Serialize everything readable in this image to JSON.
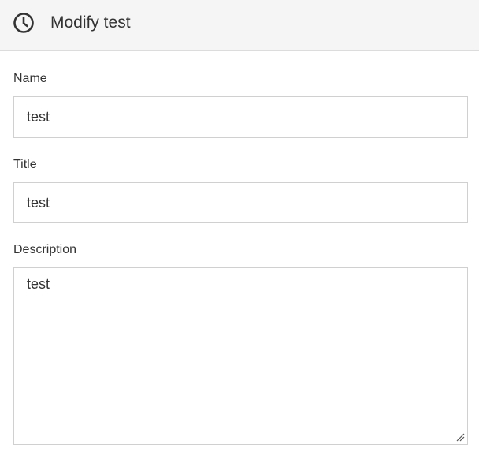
{
  "header": {
    "title": "Modify test",
    "icon": "clock-icon"
  },
  "form": {
    "name": {
      "label": "Name",
      "value": "test"
    },
    "title": {
      "label": "Title",
      "value": "test"
    },
    "description": {
      "label": "Description",
      "value": "test"
    }
  },
  "colors": {
    "header_bg": "#f5f5f5",
    "border": "#d0d0d0",
    "text": "#333333"
  }
}
